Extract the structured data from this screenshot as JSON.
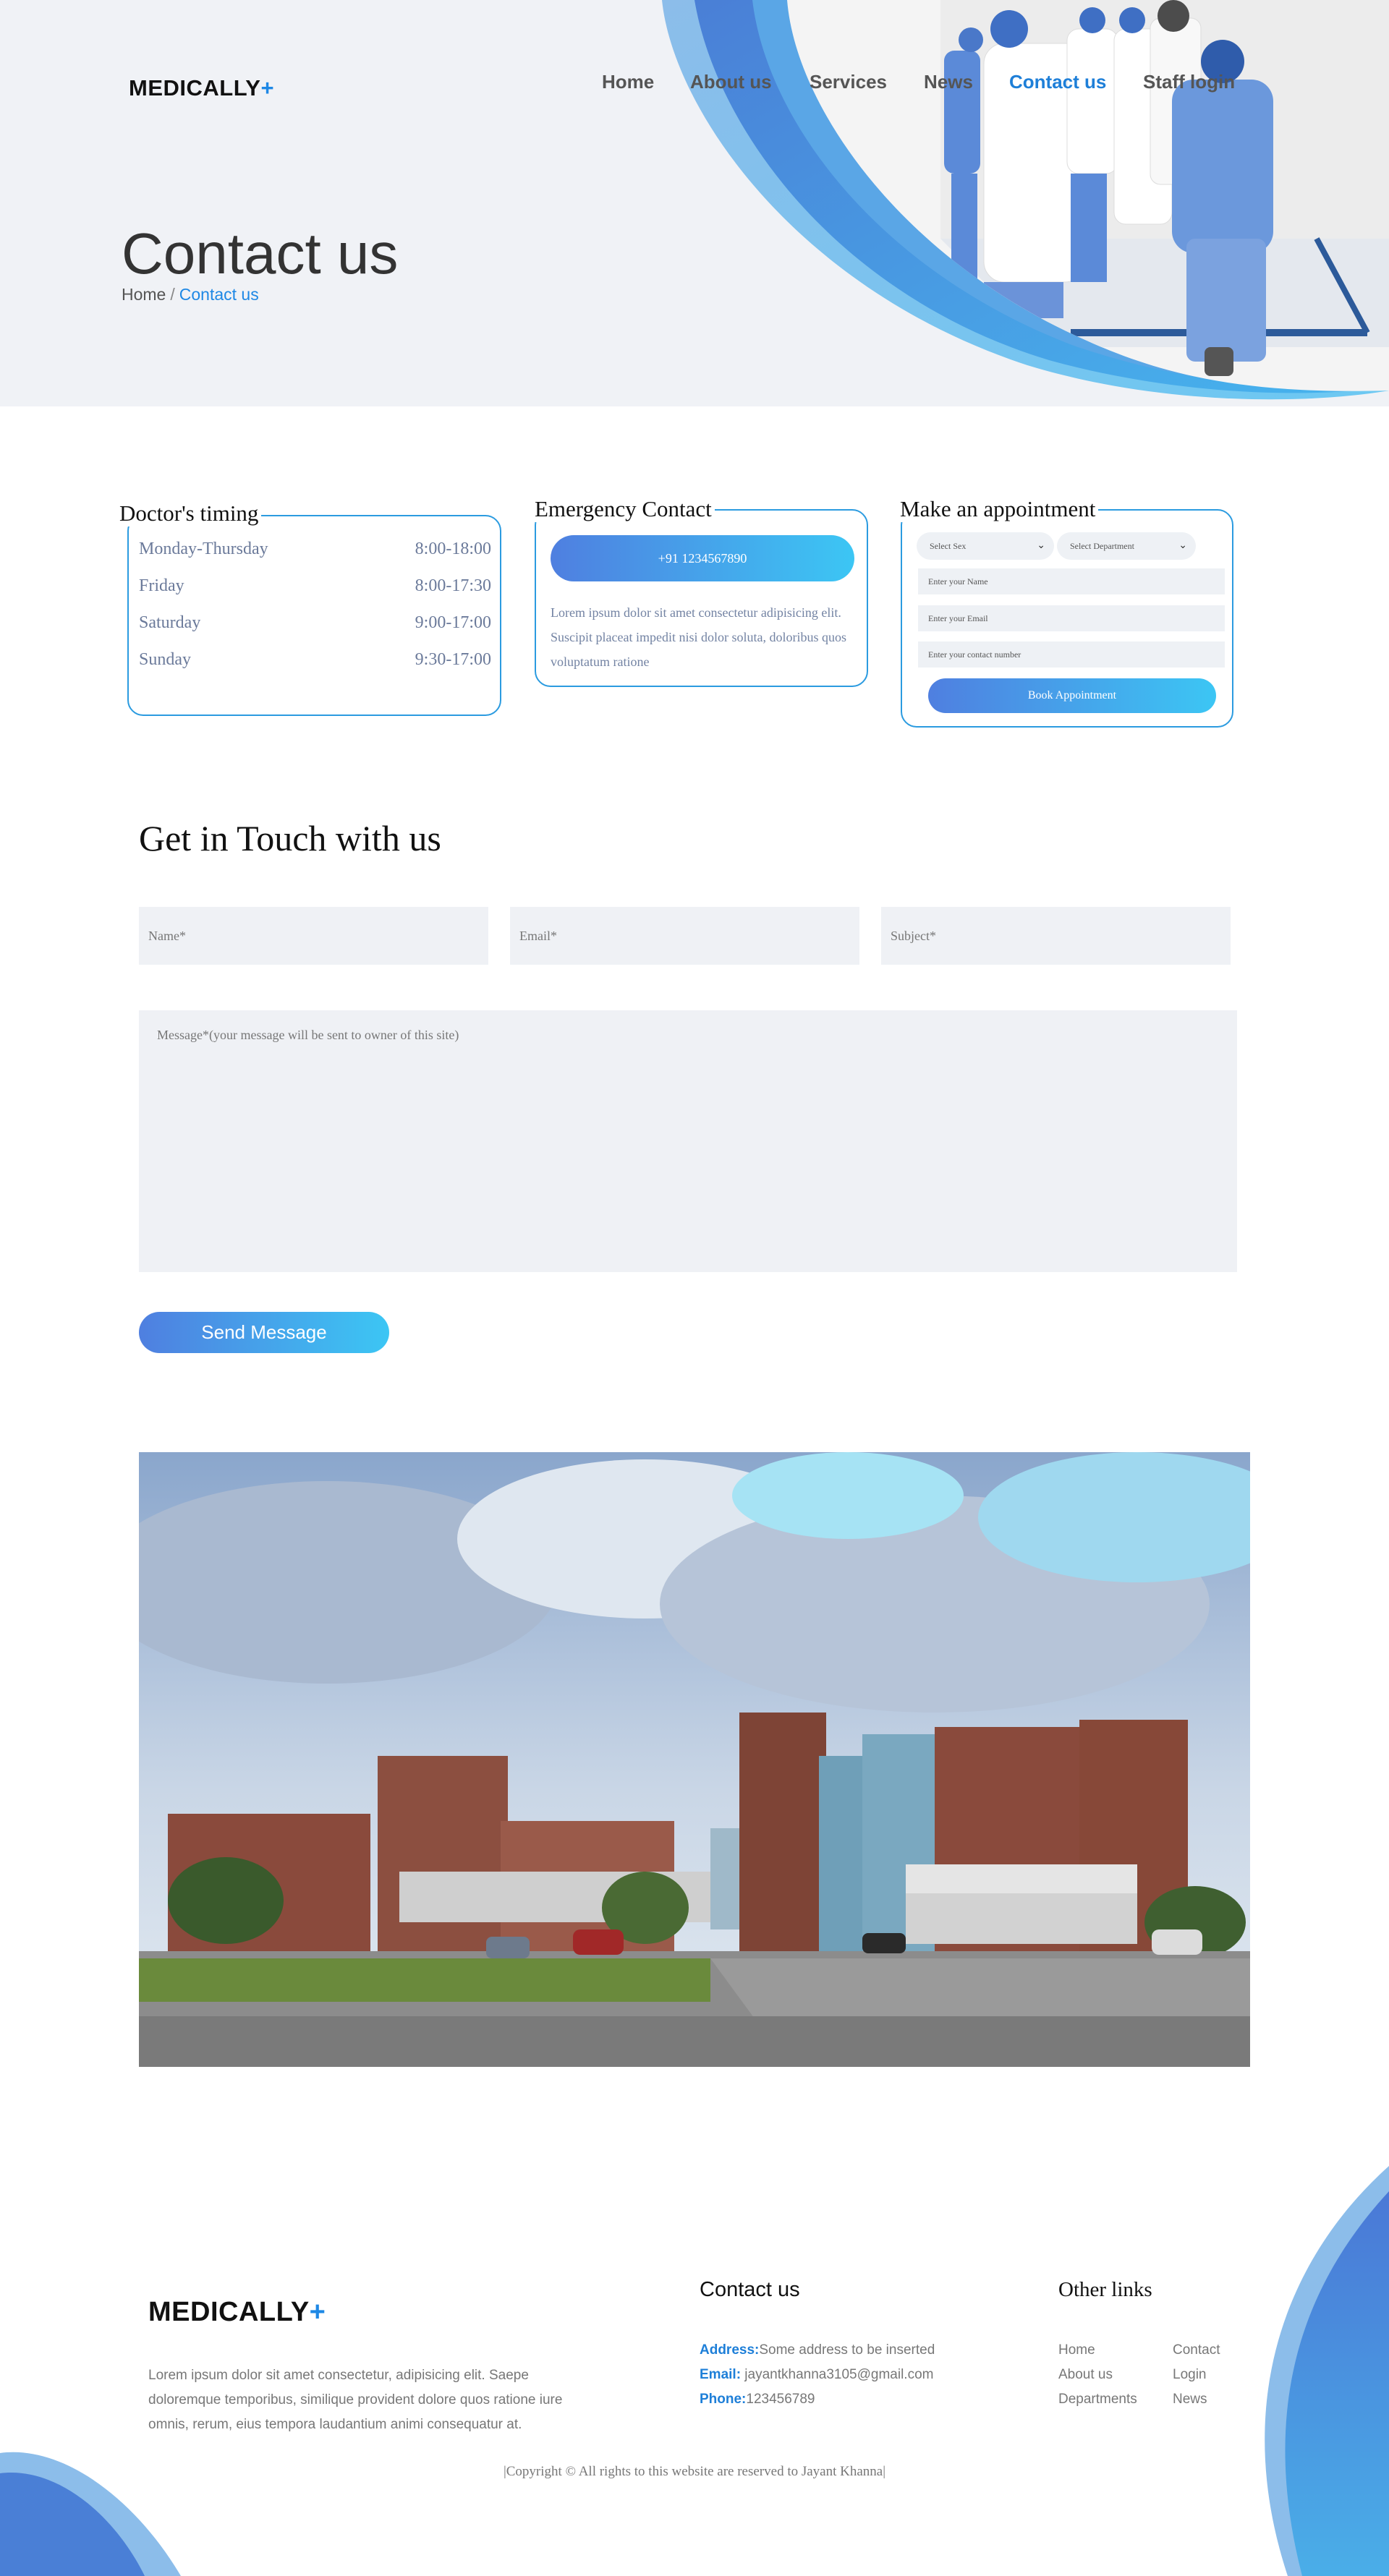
{
  "brand": {
    "name": "MEDICALLY",
    "plus": "+"
  },
  "nav": {
    "items": [
      "Home",
      "About us",
      "Services",
      "News",
      "Contact us",
      "Staff login"
    ],
    "active": "Contact us"
  },
  "hero": {
    "title": "Contact us",
    "breadcrumb_home": "Home",
    "breadcrumb_sep": "/",
    "breadcrumb_current": "Contact us"
  },
  "timing": {
    "title": "Doctor's timing",
    "rows": [
      {
        "day": "Monday-Thursday",
        "hours": "8:00-18:00"
      },
      {
        "day": "Friday",
        "hours": "8:00-17:30"
      },
      {
        "day": "Saturday",
        "hours": "9:00-17:00"
      },
      {
        "day": "Sunday",
        "hours": "9:30-17:00"
      }
    ]
  },
  "emergency": {
    "title": "Emergency Contact",
    "phone": "+91 1234567890",
    "text": "Lorem ipsum dolor sit amet consectetur adipisicing elit. Suscipit placeat impedit nisi dolor soluta, doloribus quos voluptatum ratione"
  },
  "appointment": {
    "title": "Make an appointment",
    "sex_select": "Select Sex",
    "department_select": "Select Department",
    "name_placeholder": "Enter your Name",
    "email_placeholder": "Enter your Email",
    "contact_placeholder": "Enter your contact number",
    "button": "Book Appointment"
  },
  "contact_form": {
    "title": "Get in Touch with us",
    "name_placeholder": "Name*",
    "email_placeholder": "Email*",
    "subject_placeholder": "Subject*",
    "message_placeholder": "Message*(your message will be sent to owner of this site)",
    "submit": "Send Message"
  },
  "footer": {
    "about": "Lorem ipsum dolor sit amet consectetur, adipisicing elit. Saepe doloremque temporibus, similique provident dolore quos ratione iure omnis, rerum, eius tempora laudantium animi consequatur at.",
    "contact_title": "Contact us",
    "address_label": "Address:",
    "address": "Some address to be inserted",
    "email_label": "Email:",
    "email": " jayantkhanna3105@gmail.com",
    "phone_label": "Phone:",
    "phone": "123456789",
    "links_title": "Other links",
    "links": [
      "Home",
      "Contact",
      "About us",
      "Login",
      "Departments",
      "News"
    ],
    "copyright": "|Copyright © All rights to this website are reserved to Jayant Khanna|"
  },
  "colors": {
    "accent": "#1e88e5",
    "gradient_start": "#4f7fe0",
    "gradient_end": "#3cc6f4",
    "card_border": "#2b9be0",
    "hero_bg": "#f0f2f6"
  }
}
